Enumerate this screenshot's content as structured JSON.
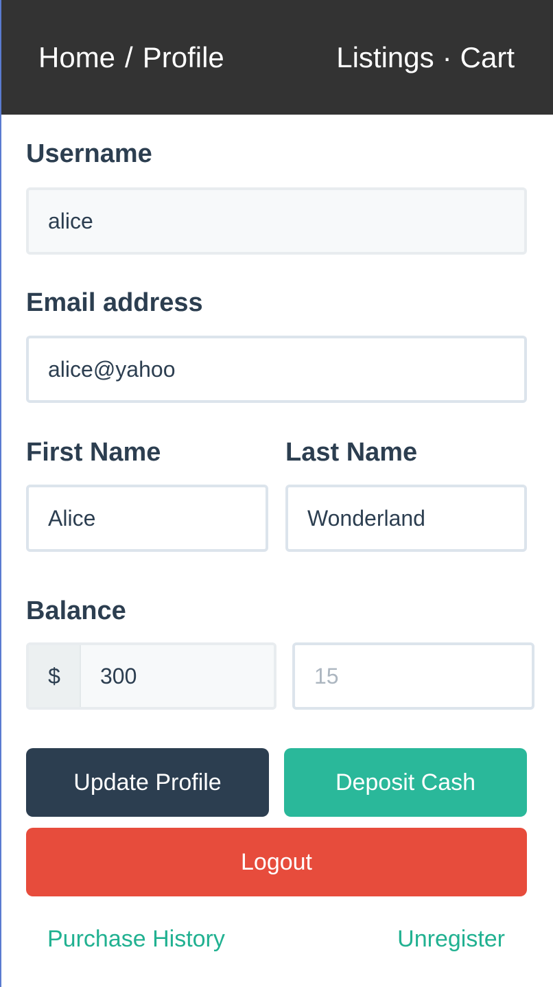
{
  "navbar": {
    "breadcrumb_home": "Home",
    "breadcrumb_sep": "/",
    "breadcrumb_current": "Profile",
    "listings": "Listings",
    "nav_dot": "·",
    "cart": "Cart"
  },
  "form": {
    "username_label": "Username",
    "username_value": "alice",
    "email_label": "Email address",
    "email_value": "alice@yahoo",
    "first_name_label": "First Name",
    "first_name_value": "Alice",
    "last_name_label": "Last Name",
    "last_name_value": "Wonderland",
    "balance_label": "Balance",
    "balance_currency": "$",
    "balance_value": "300",
    "deposit_placeholder": "15"
  },
  "buttons": {
    "update_profile": "Update Profile",
    "deposit_cash": "Deposit Cash",
    "logout": "Logout"
  },
  "links": {
    "purchase_history": "Purchase History",
    "unregister": "Unregister"
  },
  "colors": {
    "navbar_bg": "#333333",
    "primary": "#2c3e50",
    "success": "#2ab89a",
    "danger": "#e74c3c",
    "link": "#21b191"
  }
}
